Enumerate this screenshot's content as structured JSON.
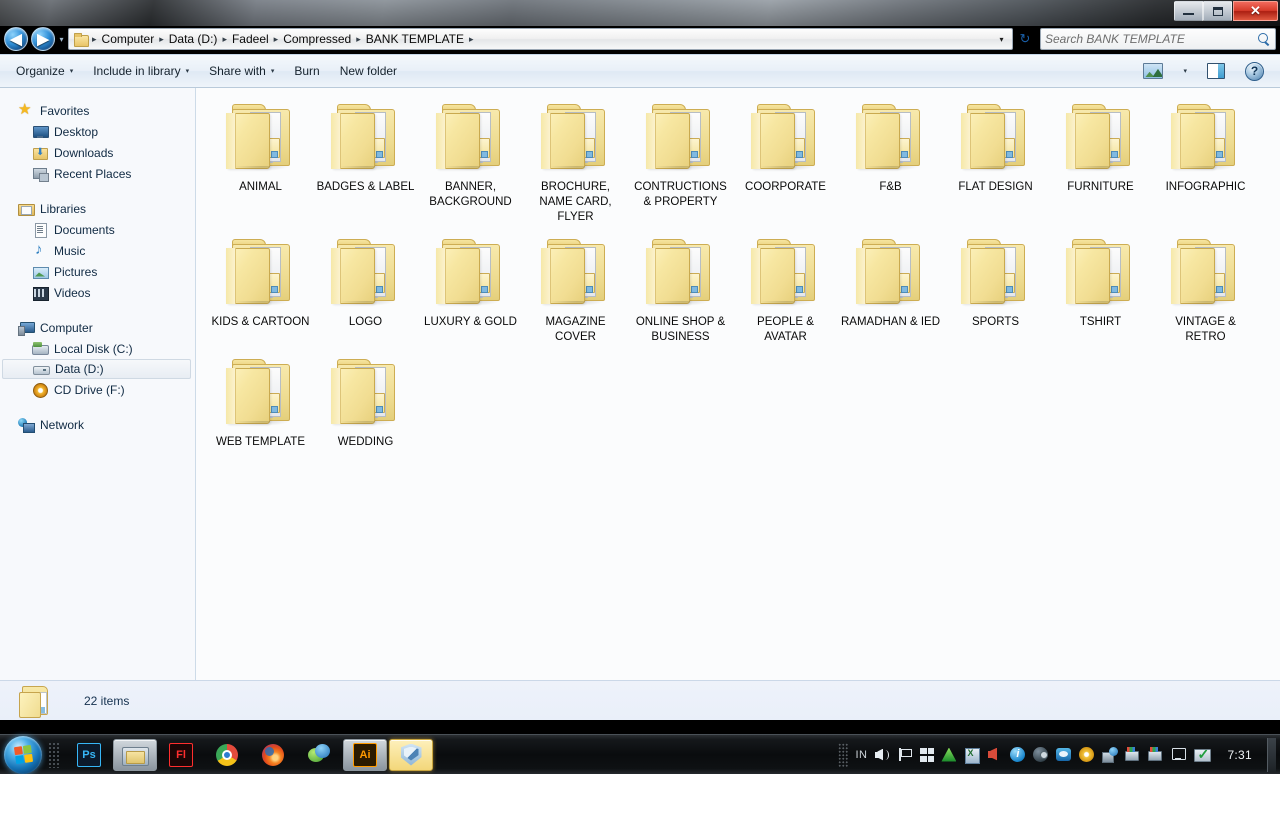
{
  "window": {
    "controls": {
      "minimize": "Minimize",
      "maximize": "Maximize",
      "close": "Close",
      "close_glyph": "✕"
    }
  },
  "address_bar": {
    "back_glyph": "◀",
    "forward_glyph": "▶",
    "history_caret": "▾",
    "dropdown_caret": "▾",
    "refresh_glyph": "↻",
    "separator": "▸",
    "crumbs": [
      "Computer",
      "Data (D:)",
      "Fadeel",
      "Compressed",
      "BANK TEMPLATE"
    ]
  },
  "search": {
    "placeholder": "Search BANK TEMPLATE",
    "value": ""
  },
  "command_bar": {
    "buttons": [
      {
        "label": "Organize",
        "has_caret": true
      },
      {
        "label": "Include in library",
        "has_caret": true
      },
      {
        "label": "Share with",
        "has_caret": true
      },
      {
        "label": "Burn",
        "has_caret": false
      },
      {
        "label": "New folder",
        "has_caret": false
      }
    ],
    "view_caret": "▾",
    "help_label": "?"
  },
  "sidebar": {
    "groups": [
      {
        "header": {
          "label": "Favorites",
          "icon": "star-icon"
        },
        "items": [
          {
            "label": "Desktop",
            "icon": "desktop-icon",
            "selected": false
          },
          {
            "label": "Downloads",
            "icon": "downloads-icon",
            "selected": false
          },
          {
            "label": "Recent Places",
            "icon": "recent-places-icon",
            "selected": false
          }
        ]
      },
      {
        "header": {
          "label": "Libraries",
          "icon": "libraries-icon"
        },
        "items": [
          {
            "label": "Documents",
            "icon": "document-icon",
            "selected": false
          },
          {
            "label": "Music",
            "icon": "music-icon",
            "selected": false
          },
          {
            "label": "Pictures",
            "icon": "pictures-icon",
            "selected": false
          },
          {
            "label": "Videos",
            "icon": "videos-icon",
            "selected": false
          }
        ]
      },
      {
        "header": {
          "label": "Computer",
          "icon": "computer-icon"
        },
        "items": [
          {
            "label": "Local Disk (C:)",
            "icon": "hard-disk-icon",
            "selected": false
          },
          {
            "label": "Data (D:)",
            "icon": "drive-icon",
            "selected": true
          },
          {
            "label": "CD Drive (F:)",
            "icon": "cd-drive-icon",
            "selected": false
          }
        ]
      },
      {
        "header": {
          "label": "Network",
          "icon": "network-icon"
        },
        "items": []
      }
    ]
  },
  "file_list": {
    "items": [
      {
        "name": "ANIMAL",
        "type": "folder"
      },
      {
        "name": "BADGES & LABEL",
        "type": "folder"
      },
      {
        "name": "BANNER, BACKGROUND",
        "type": "folder"
      },
      {
        "name": "BROCHURE, NAME CARD, FLYER",
        "type": "folder"
      },
      {
        "name": "CONTRUCTIONS & PROPERTY",
        "type": "folder"
      },
      {
        "name": "COORPORATE",
        "type": "folder"
      },
      {
        "name": "F&B",
        "type": "folder"
      },
      {
        "name": "FLAT DESIGN",
        "type": "folder"
      },
      {
        "name": "FURNITURE",
        "type": "folder"
      },
      {
        "name": "INFOGRAPHIC",
        "type": "folder"
      },
      {
        "name": "KIDS & CARTOON",
        "type": "folder"
      },
      {
        "name": "LOGO",
        "type": "folder"
      },
      {
        "name": "LUXURY & GOLD",
        "type": "folder"
      },
      {
        "name": "MAGAZINE COVER",
        "type": "folder"
      },
      {
        "name": "ONLINE SHOP & BUSINESS",
        "type": "folder"
      },
      {
        "name": "PEOPLE & AVATAR",
        "type": "folder"
      },
      {
        "name": "RAMADHAN & IED",
        "type": "folder"
      },
      {
        "name": "SPORTS",
        "type": "folder"
      },
      {
        "name": "TSHIRT",
        "type": "folder"
      },
      {
        "name": "VINTAGE & RETRO",
        "type": "folder"
      },
      {
        "name": "WEB TEMPLATE",
        "type": "folder"
      },
      {
        "name": "WEDDING",
        "type": "folder"
      }
    ]
  },
  "status_bar": {
    "item_count": "22 items"
  },
  "taskbar": {
    "start_label": "Start",
    "apps": [
      {
        "name": "photoshop",
        "label": "Ps",
        "style": "ai-ps",
        "active": false,
        "pinned_plain": true
      },
      {
        "name": "windows-explorer",
        "label": "",
        "style": "ai-explorer",
        "active": false,
        "window_button": true
      },
      {
        "name": "flash",
        "label": "Fl",
        "style": "ai-fl",
        "active": false,
        "pinned_plain": true
      },
      {
        "name": "google-chrome",
        "label": "",
        "style": "ai-chrome",
        "active": false,
        "pinned_plain": true
      },
      {
        "name": "firefox",
        "label": "",
        "style": "ai-ff",
        "active": false,
        "pinned_plain": true
      },
      {
        "name": "download-manager",
        "label": "",
        "style": "ai-idm",
        "active": false,
        "pinned_plain": true
      },
      {
        "name": "illustrator",
        "label": "Ai",
        "style": "ai-ai",
        "active": false,
        "window_button": true
      },
      {
        "name": "security-shield",
        "label": "",
        "style": "ai-shield",
        "active": true,
        "window_button": true
      }
    ],
    "tray": {
      "language": "IN",
      "icons": [
        {
          "name": "volume-icon",
          "style": "ti-vol"
        },
        {
          "name": "action-center-flag-icon",
          "style": "ti-flag"
        },
        {
          "name": "windows-icon",
          "style": "ti-win"
        },
        {
          "name": "green-triangle-icon",
          "style": "ti-tri"
        },
        {
          "name": "spreadsheet-icon",
          "style": "ti-xl"
        },
        {
          "name": "red-speaker-icon",
          "style": "ti-spk"
        },
        {
          "name": "info-icon",
          "style": "ti-info"
        },
        {
          "name": "steam-icon",
          "style": "ti-steam"
        },
        {
          "name": "messenger-icon",
          "style": "ti-msn"
        },
        {
          "name": "disc-icon",
          "style": "ti-disc"
        },
        {
          "name": "network-tray-icon",
          "style": "ti-net"
        },
        {
          "name": "printer-icon",
          "style": "ti-print"
        },
        {
          "name": "printer-icon-2",
          "style": "ti-print"
        },
        {
          "name": "remote-display-icon",
          "style": "ti-mon"
        },
        {
          "name": "checkmark-icon",
          "style": "ti-chk"
        }
      ],
      "clock": "7:31"
    }
  },
  "colors": {
    "accent": "#1f6fb5",
    "folder_yellow": "#f1dd92",
    "close_red": "#d63b2a",
    "content_bg": "#fbfcfd",
    "sidebar_bg": "#f7f9fc"
  }
}
